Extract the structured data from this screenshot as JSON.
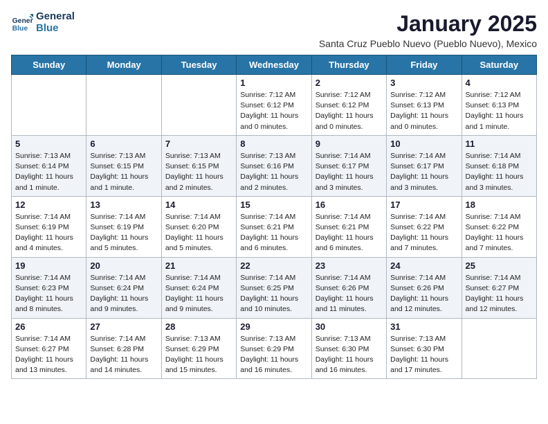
{
  "logo": {
    "line1": "General",
    "line2": "Blue"
  },
  "title": "January 2025",
  "location": "Santa Cruz Pueblo Nuevo (Pueblo Nuevo), Mexico",
  "days_of_week": [
    "Sunday",
    "Monday",
    "Tuesday",
    "Wednesday",
    "Thursday",
    "Friday",
    "Saturday"
  ],
  "weeks": [
    [
      {
        "day": "",
        "info": ""
      },
      {
        "day": "",
        "info": ""
      },
      {
        "day": "",
        "info": ""
      },
      {
        "day": "1",
        "info": "Sunrise: 7:12 AM\nSunset: 6:12 PM\nDaylight: 11 hours and 0 minutes."
      },
      {
        "day": "2",
        "info": "Sunrise: 7:12 AM\nSunset: 6:12 PM\nDaylight: 11 hours and 0 minutes."
      },
      {
        "day": "3",
        "info": "Sunrise: 7:12 AM\nSunset: 6:13 PM\nDaylight: 11 hours and 0 minutes."
      },
      {
        "day": "4",
        "info": "Sunrise: 7:12 AM\nSunset: 6:13 PM\nDaylight: 11 hours and 1 minute."
      }
    ],
    [
      {
        "day": "5",
        "info": "Sunrise: 7:13 AM\nSunset: 6:14 PM\nDaylight: 11 hours and 1 minute."
      },
      {
        "day": "6",
        "info": "Sunrise: 7:13 AM\nSunset: 6:15 PM\nDaylight: 11 hours and 1 minute."
      },
      {
        "day": "7",
        "info": "Sunrise: 7:13 AM\nSunset: 6:15 PM\nDaylight: 11 hours and 2 minutes."
      },
      {
        "day": "8",
        "info": "Sunrise: 7:13 AM\nSunset: 6:16 PM\nDaylight: 11 hours and 2 minutes."
      },
      {
        "day": "9",
        "info": "Sunrise: 7:14 AM\nSunset: 6:17 PM\nDaylight: 11 hours and 3 minutes."
      },
      {
        "day": "10",
        "info": "Sunrise: 7:14 AM\nSunset: 6:17 PM\nDaylight: 11 hours and 3 minutes."
      },
      {
        "day": "11",
        "info": "Sunrise: 7:14 AM\nSunset: 6:18 PM\nDaylight: 11 hours and 3 minutes."
      }
    ],
    [
      {
        "day": "12",
        "info": "Sunrise: 7:14 AM\nSunset: 6:19 PM\nDaylight: 11 hours and 4 minutes."
      },
      {
        "day": "13",
        "info": "Sunrise: 7:14 AM\nSunset: 6:19 PM\nDaylight: 11 hours and 5 minutes."
      },
      {
        "day": "14",
        "info": "Sunrise: 7:14 AM\nSunset: 6:20 PM\nDaylight: 11 hours and 5 minutes."
      },
      {
        "day": "15",
        "info": "Sunrise: 7:14 AM\nSunset: 6:21 PM\nDaylight: 11 hours and 6 minutes."
      },
      {
        "day": "16",
        "info": "Sunrise: 7:14 AM\nSunset: 6:21 PM\nDaylight: 11 hours and 6 minutes."
      },
      {
        "day": "17",
        "info": "Sunrise: 7:14 AM\nSunset: 6:22 PM\nDaylight: 11 hours and 7 minutes."
      },
      {
        "day": "18",
        "info": "Sunrise: 7:14 AM\nSunset: 6:22 PM\nDaylight: 11 hours and 7 minutes."
      }
    ],
    [
      {
        "day": "19",
        "info": "Sunrise: 7:14 AM\nSunset: 6:23 PM\nDaylight: 11 hours and 8 minutes."
      },
      {
        "day": "20",
        "info": "Sunrise: 7:14 AM\nSunset: 6:24 PM\nDaylight: 11 hours and 9 minutes."
      },
      {
        "day": "21",
        "info": "Sunrise: 7:14 AM\nSunset: 6:24 PM\nDaylight: 11 hours and 9 minutes."
      },
      {
        "day": "22",
        "info": "Sunrise: 7:14 AM\nSunset: 6:25 PM\nDaylight: 11 hours and 10 minutes."
      },
      {
        "day": "23",
        "info": "Sunrise: 7:14 AM\nSunset: 6:26 PM\nDaylight: 11 hours and 11 minutes."
      },
      {
        "day": "24",
        "info": "Sunrise: 7:14 AM\nSunset: 6:26 PM\nDaylight: 11 hours and 12 minutes."
      },
      {
        "day": "25",
        "info": "Sunrise: 7:14 AM\nSunset: 6:27 PM\nDaylight: 11 hours and 12 minutes."
      }
    ],
    [
      {
        "day": "26",
        "info": "Sunrise: 7:14 AM\nSunset: 6:27 PM\nDaylight: 11 hours and 13 minutes."
      },
      {
        "day": "27",
        "info": "Sunrise: 7:14 AM\nSunset: 6:28 PM\nDaylight: 11 hours and 14 minutes."
      },
      {
        "day": "28",
        "info": "Sunrise: 7:13 AM\nSunset: 6:29 PM\nDaylight: 11 hours and 15 minutes."
      },
      {
        "day": "29",
        "info": "Sunrise: 7:13 AM\nSunset: 6:29 PM\nDaylight: 11 hours and 16 minutes."
      },
      {
        "day": "30",
        "info": "Sunrise: 7:13 AM\nSunset: 6:30 PM\nDaylight: 11 hours and 16 minutes."
      },
      {
        "day": "31",
        "info": "Sunrise: 7:13 AM\nSunset: 6:30 PM\nDaylight: 11 hours and 17 minutes."
      },
      {
        "day": "",
        "info": ""
      }
    ]
  ]
}
